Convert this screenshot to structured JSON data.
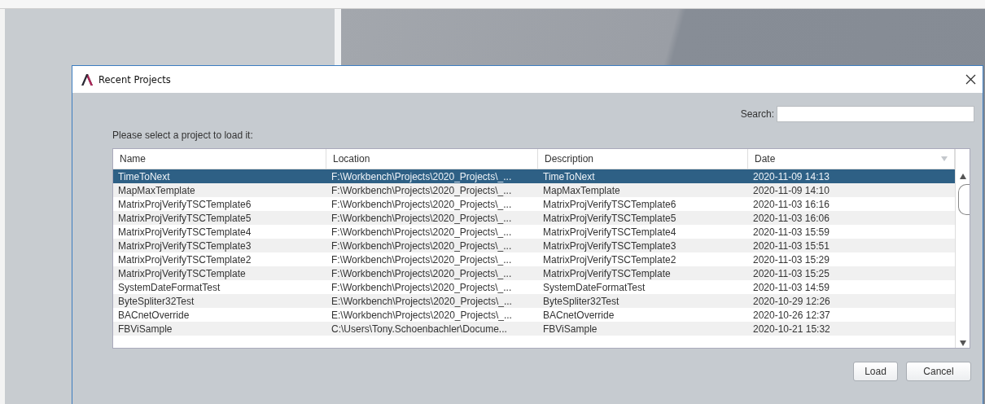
{
  "dialog": {
    "title": "Recent Projects",
    "search": {
      "label": "Search:"
    },
    "prompt": "Please select a project to load it:",
    "table": {
      "columns": [
        {
          "label": "Name",
          "sorted": false
        },
        {
          "label": "Location",
          "sorted": false
        },
        {
          "label": "Description",
          "sorted": false
        },
        {
          "label": "Date",
          "sorted": true
        }
      ],
      "rows": [
        {
          "cells": [
            "TimeToNext",
            "F:\\Workbench\\Projects\\2020_Projects\\_...",
            "TimeToNext",
            "2020-11-09 14:13"
          ],
          "selected": true
        },
        {
          "cells": [
            "MapMaxTemplate",
            "F:\\Workbench\\Projects\\2020_Projects\\_...",
            "MapMaxTemplate",
            "2020-11-09 14:10"
          ],
          "selected": false
        },
        {
          "cells": [
            "MatrixProjVerifyTSCTemplate6",
            "F:\\Workbench\\Projects\\2020_Projects\\_...",
            "MatrixProjVerifyTSCTemplate6",
            "2020-11-03 16:16"
          ],
          "selected": false
        },
        {
          "cells": [
            "MatrixProjVerifyTSCTemplate5",
            "F:\\Workbench\\Projects\\2020_Projects\\_...",
            "MatrixProjVerifyTSCTemplate5",
            "2020-11-03 16:06"
          ],
          "selected": false
        },
        {
          "cells": [
            "MatrixProjVerifyTSCTemplate4",
            "F:\\Workbench\\Projects\\2020_Projects\\_...",
            "MatrixProjVerifyTSCTemplate4",
            "2020-11-03 15:59"
          ],
          "selected": false
        },
        {
          "cells": [
            "MatrixProjVerifyTSCTemplate3",
            "F:\\Workbench\\Projects\\2020_Projects\\_...",
            "MatrixProjVerifyTSCTemplate3",
            "2020-11-03 15:51"
          ],
          "selected": false
        },
        {
          "cells": [
            "MatrixProjVerifyTSCTemplate2",
            "F:\\Workbench\\Projects\\2020_Projects\\_...",
            "MatrixProjVerifyTSCTemplate2",
            "2020-11-03 15:29"
          ],
          "selected": false
        },
        {
          "cells": [
            "MatrixProjVerifyTSCTemplate",
            "F:\\Workbench\\Projects\\2020_Projects\\_...",
            "MatrixProjVerifyTSCTemplate",
            "2020-11-03 15:25"
          ],
          "selected": false
        },
        {
          "cells": [
            "SystemDateFormatTest",
            "F:\\Workbench\\Projects\\2020_Projects\\_...",
            "SystemDateFormatTest",
            "2020-11-03 14:59"
          ],
          "selected": false
        },
        {
          "cells": [
            "ByteSpliter32Test",
            "E:\\Workbench\\Projects\\2020_Projects\\_...",
            "ByteSpliter32Test",
            "2020-10-29 12:26"
          ],
          "selected": false
        },
        {
          "cells": [
            "BACnetOverride",
            "E:\\Workbench\\Projects\\2020_Projects\\_...",
            "BACnetOverride",
            "2020-10-26 12:37"
          ],
          "selected": false
        },
        {
          "cells": [
            "FBViSample",
            "C:\\Users\\Tony.Schoenbachler\\Docume...",
            "FBViSample",
            "2020-10-21 15:32"
          ],
          "selected": false
        }
      ]
    },
    "buttons": [
      "Load",
      "Cancel"
    ]
  }
}
